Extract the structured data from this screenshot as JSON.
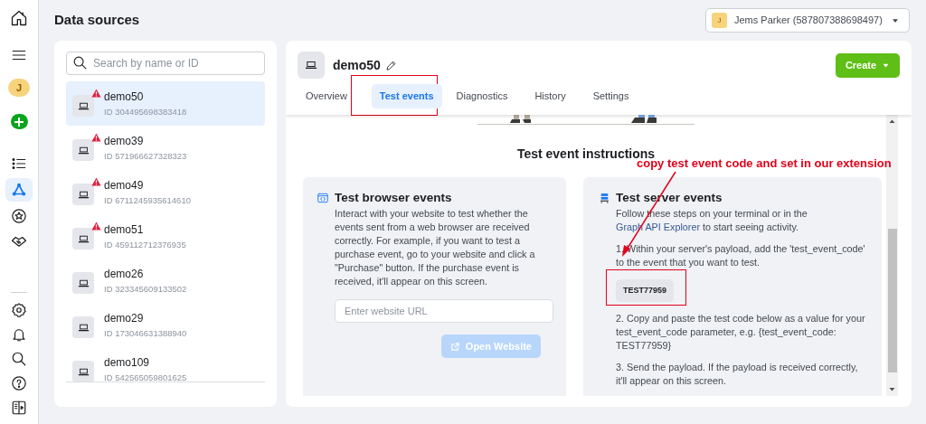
{
  "rail": {
    "avatar": "J",
    "nav": [
      {
        "kind": "list",
        "selected": false
      },
      {
        "kind": "graph",
        "selected": true
      },
      {
        "kind": "star",
        "selected": false
      },
      {
        "kind": "handshake",
        "selected": false
      }
    ]
  },
  "page_title": "Data sources",
  "account": {
    "avatar": "J",
    "label": "Jems Parker (587807388698497)"
  },
  "sources": {
    "search_placeholder": "Search by name or ID",
    "items": [
      {
        "name": "demo50",
        "id": "ID 304495698383418",
        "warning": true,
        "selected": true
      },
      {
        "name": "demo39",
        "id": "ID 571966627328323",
        "warning": true,
        "selected": false
      },
      {
        "name": "demo49",
        "id": "ID 6711245935614610",
        "warning": true,
        "selected": false
      },
      {
        "name": "demo51",
        "id": "ID 459112712376935",
        "warning": true,
        "selected": false
      },
      {
        "name": "demo26",
        "id": "ID 323345609133502",
        "warning": false,
        "selected": false
      },
      {
        "name": "demo29",
        "id": "ID 173046631388940",
        "warning": false,
        "selected": false
      },
      {
        "name": "demo109",
        "id": "ID 542565059801625",
        "warning": false,
        "selected": false
      }
    ]
  },
  "detail": {
    "name": "demo50",
    "create_button": "Create",
    "tabs": [
      {
        "label": "Overview",
        "selected": false
      },
      {
        "label": "Test events",
        "selected": true
      },
      {
        "label": "Diagnostics",
        "selected": false
      },
      {
        "label": "History",
        "selected": false
      },
      {
        "label": "Settings",
        "selected": false
      }
    ],
    "section_title": "Test event instructions",
    "browser_card": {
      "title": "Test browser events",
      "description": "Interact with your website to test whether the events sent from a web browser are received correctly. For example, if you want to test a purchase event, go to your website and click a \"Purchase\" button. If the purchase event is received, it'll appear on this screen.",
      "url_placeholder": "Enter website URL",
      "button": "Open Website",
      "button_disabled": true
    },
    "server_card": {
      "title": "Test server events",
      "intro_before": "Follow these steps on your terminal or in the",
      "link": "Graph API Explorer",
      "intro_after": "to start seeing activity.",
      "step_1": "1. Within your server's payload, add the 'test_event_code' to the event that you want to test.",
      "code": "TEST77959",
      "step_2": "2. Copy and paste the test code below as a value for your test_event_code parameter, e.g. {test_event_code: TEST77959}",
      "step_3": "3. Send the payload. If the payload is received correctly, it'll appear on this screen."
    }
  },
  "annotation": {
    "text": "copy test event code and set in our extension"
  }
}
